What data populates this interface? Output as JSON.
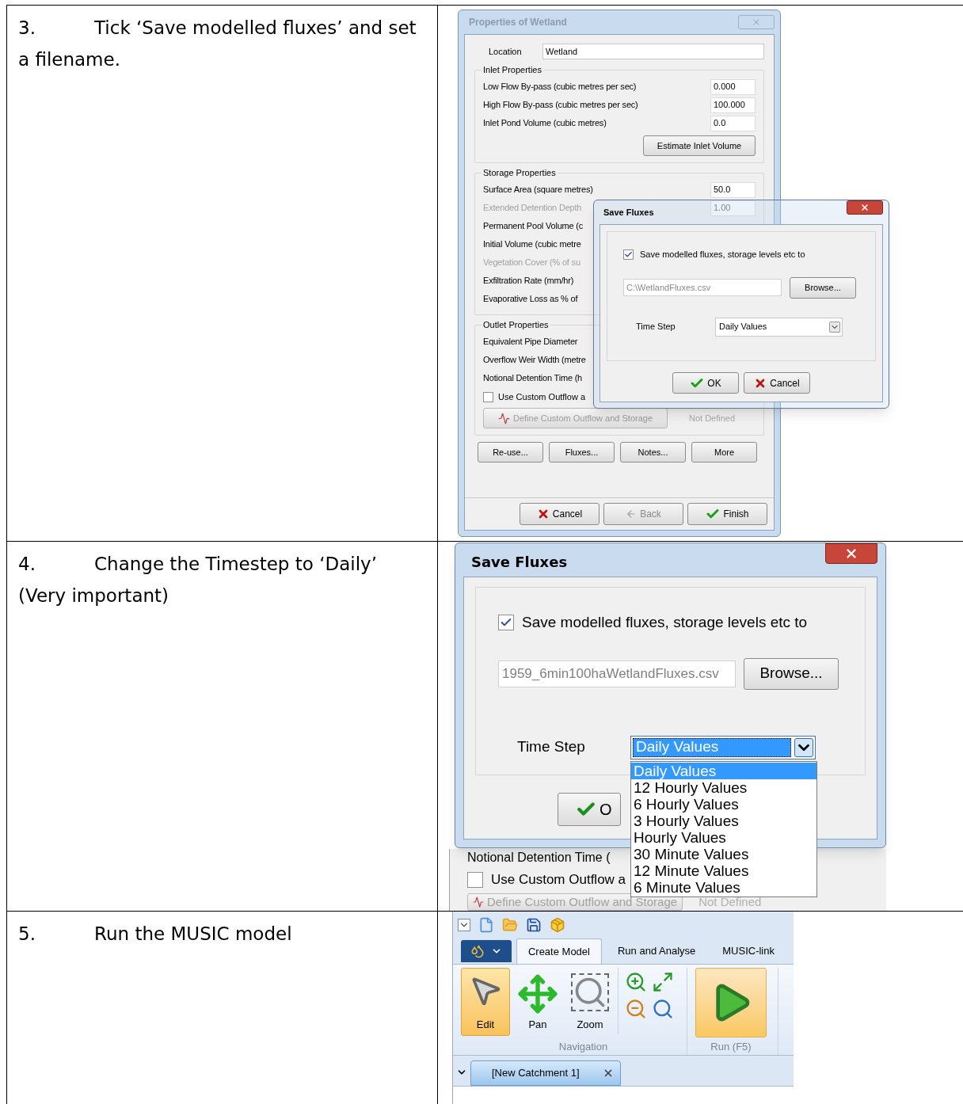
{
  "rows": [
    {
      "number": "3.",
      "instruction": "Tick ‘Save modelled fluxes’ and set a filename.",
      "screenshot": {
        "kind": "properties_with_save_fluxes",
        "properties_window": {
          "title": "Properties of Wetland",
          "location_label": "Location",
          "location_value": "Wetland",
          "groups": [
            {
              "title": "Inlet Properties",
              "fields": [
                {
                  "label": "Low Flow By-pass (cubic metres per sec)",
                  "value": "0.000",
                  "disabled": false
                },
                {
                  "label": "High Flow By-pass (cubic metres per sec)",
                  "value": "100.000",
                  "disabled": false
                },
                {
                  "label": "Inlet Pond Volume (cubic metres)",
                  "value": "0.0",
                  "disabled": false
                }
              ],
              "button": "Estimate Inlet Volume"
            },
            {
              "title": "Storage Properties",
              "fields": [
                {
                  "label": "Surface Area (square metres)",
                  "value": "50.0",
                  "disabled": false
                },
                {
                  "label": "Extended Detention Depth",
                  "value": "1.00",
                  "disabled": true
                },
                {
                  "label": "Permanent Pool Volume (c",
                  "disabled": false
                },
                {
                  "label": "Initial Volume (cubic metre",
                  "disabled": false
                },
                {
                  "label": "Vegetation Cover (% of su",
                  "disabled": true
                },
                {
                  "label": "Exfiltration Rate (mm/hr)",
                  "disabled": false
                },
                {
                  "label": "Evaporative Loss as % of",
                  "disabled": false
                }
              ]
            },
            {
              "title": "Outlet Properties",
              "fields": [
                {
                  "label": "Equivalent Pipe Diameter",
                  "disabled": false
                },
                {
                  "label": "Overflow Weir Width (metre",
                  "disabled": false
                },
                {
                  "label": "Notional Detention Time (h",
                  "disabled": false
                }
              ],
              "checkbox": {
                "label": "Use Custom Outflow a",
                "checked": false
              },
              "define_button": "Define Custom Outflow and Storage",
              "define_status": "Not Defined"
            }
          ],
          "buttons": [
            "Re-use...",
            "Fluxes...",
            "Notes...",
            "More"
          ],
          "footer_buttons": [
            {
              "kind": "cancel",
              "label": "Cancel",
              "disabled": false
            },
            {
              "kind": "back",
              "label": "Back",
              "disabled": true
            },
            {
              "kind": "finish",
              "label": "Finish",
              "disabled": false
            }
          ]
        },
        "save_fluxes": {
          "title": "Save Fluxes",
          "checkbox": {
            "label": "Save modelled fluxes, storage levels etc to",
            "checked": true
          },
          "file": "C:\\WetlandFluxes.csv",
          "browse": "Browse...",
          "time_step_label": "Time Step",
          "time_step": "Daily Values",
          "ok": "OK",
          "cancel": "Cancel"
        }
      }
    },
    {
      "number": "4.",
      "instruction": "Change the Timestep to ‘Daily’ (Very important)",
      "screenshot": {
        "kind": "save_fluxes_dropdown",
        "save_fluxes": {
          "title": "Save Fluxes",
          "checkbox": {
            "label": "Save modelled fluxes, storage levels etc to",
            "checked": true
          },
          "file": "1959_6min100haWetlandFluxes.csv",
          "browse": "Browse...",
          "time_step_label": "Time Step",
          "time_step": "Daily Values",
          "ok": "O",
          "options": [
            {
              "label": "Daily Values",
              "selected": true
            },
            {
              "label": "12 Hourly Values",
              "selected": false
            },
            {
              "label": "6 Hourly Values",
              "selected": false
            },
            {
              "label": "3 Hourly Values",
              "selected": false
            },
            {
              "label": "Hourly Values",
              "selected": false
            },
            {
              "label": "30 Minute Values",
              "selected": false
            },
            {
              "label": "12 Minute Values",
              "selected": false
            },
            {
              "label": "6 Minute Values",
              "selected": false
            }
          ]
        },
        "background": {
          "label": "Notional Detention Time (",
          "checkbox": {
            "label": "Use Custom Outflow a",
            "checked": false
          },
          "define_button": "Define Custom Outflow and Storage",
          "define_status": "Not Defined"
        }
      }
    },
    {
      "number": "5.",
      "instruction": "Run the MUSIC model",
      "screenshot": {
        "kind": "ribbon",
        "tabs": [
          {
            "label": "Create Model",
            "selected": true
          },
          {
            "label": "Run and Analyse",
            "selected": false
          },
          {
            "label": "MUSIC-link",
            "selected": false
          }
        ],
        "tools": [
          {
            "kind": "edit",
            "label": "Edit",
            "selected": true
          },
          {
            "kind": "pan",
            "label": "Pan",
            "selected": false
          },
          {
            "kind": "zoom",
            "label": "Zoom",
            "selected": false
          }
        ],
        "group_label": "Navigation",
        "run": {
          "label": "Run (F5)",
          "active": true
        },
        "document_tab": "[New Catchment 1]"
      }
    }
  ]
}
